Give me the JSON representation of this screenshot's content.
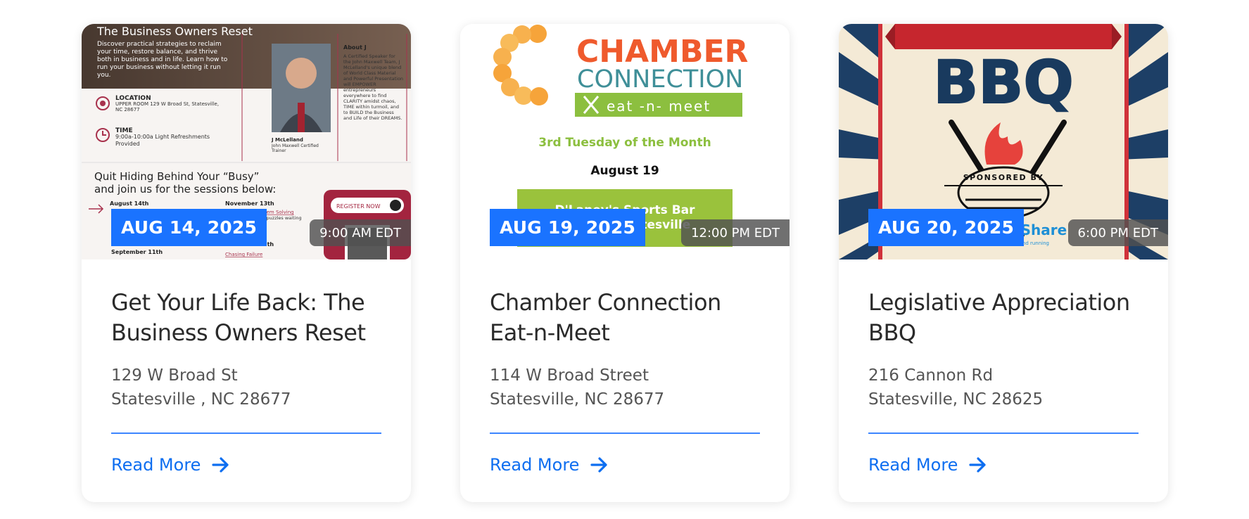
{
  "colors": {
    "accent": "#1a73ff",
    "link": "#0e6ef0",
    "divider": "#3d86ff"
  },
  "events": [
    {
      "date": "AUG 14, 2025",
      "time": "9:00 AM EDT",
      "title": "Get Your Life Back: The Business Owners Reset",
      "address_line1": "129 W Broad St",
      "address_line2": "Statesville , NC 28677",
      "read_more": "Read More",
      "flyer": {
        "heading": "The Business Owners Reset",
        "intro": "Discover practical strategies to reclaim your time, restore balance, and thrive both in business and in life. Learn how to run your business without letting it run you.",
        "location_label": "LOCATION",
        "location_text": "UPPER ROOM 129 W Broad St, Statesville, NC 28677",
        "time_label": "TIME",
        "time_text": "9:00a-10:00a Light Refreshments Provided",
        "about_label": "About J",
        "about_text": "A Certified Speaker for the John Maxwell Team, J McLelland's unique blend of World Class Material and Powerful Presentation will EMPOWER entrepreneurs everywhere to find CLARITY amidst chaos, TIME within turmoil, and to BUILD the Business and Life of their DREAMS.",
        "speaker_name": "J McLelland",
        "speaker_role": "John Maxwell Certified Trainer",
        "tagline_1": "Quit Hiding Behind Your “Busy”",
        "tagline_2": "and join us for the sessions below:",
        "session_1": "August 14th",
        "session_2": "November 13th",
        "session_2_topic": "Law of Problem Solving",
        "session_2_desc": "Problems are just puzzles waiting to be solved.",
        "session_3": "September 11th",
        "session_4": "December 11th",
        "session_4_topic": "Chasing Failure",
        "register": "REGISTER NOW"
      }
    },
    {
      "date": "AUG 19, 2025",
      "time": "12:00 PM EDT",
      "title": "Chamber Connection Eat-n-Meet",
      "address_line1": "114 W Broad Street",
      "address_line2": "Statesville, NC 28677",
      "read_more": "Read More",
      "flyer": {
        "word1": "CHAMBER",
        "word2": "CONNECTION",
        "subtitle": "eat -n- meet",
        "schedule": "3rd Tuesday of the Month",
        "date": "August 19",
        "venue_line1": "D'Laney's Sports Bar",
        "venue_line2": "St, Statesville"
      }
    },
    {
      "date": "AUG 20, 2025",
      "time": "6:00 PM EDT",
      "title": "Legislative Appreciation BBQ",
      "address_line1": "216 Cannon Rd",
      "address_line2": "Statesville, NC 28625",
      "read_more": "Read More",
      "flyer": {
        "heading": "BBQ",
        "sponsored": "SPONSORED BY",
        "sponsor": "eShare",
        "sponsor_tag": "ground running"
      }
    }
  ]
}
